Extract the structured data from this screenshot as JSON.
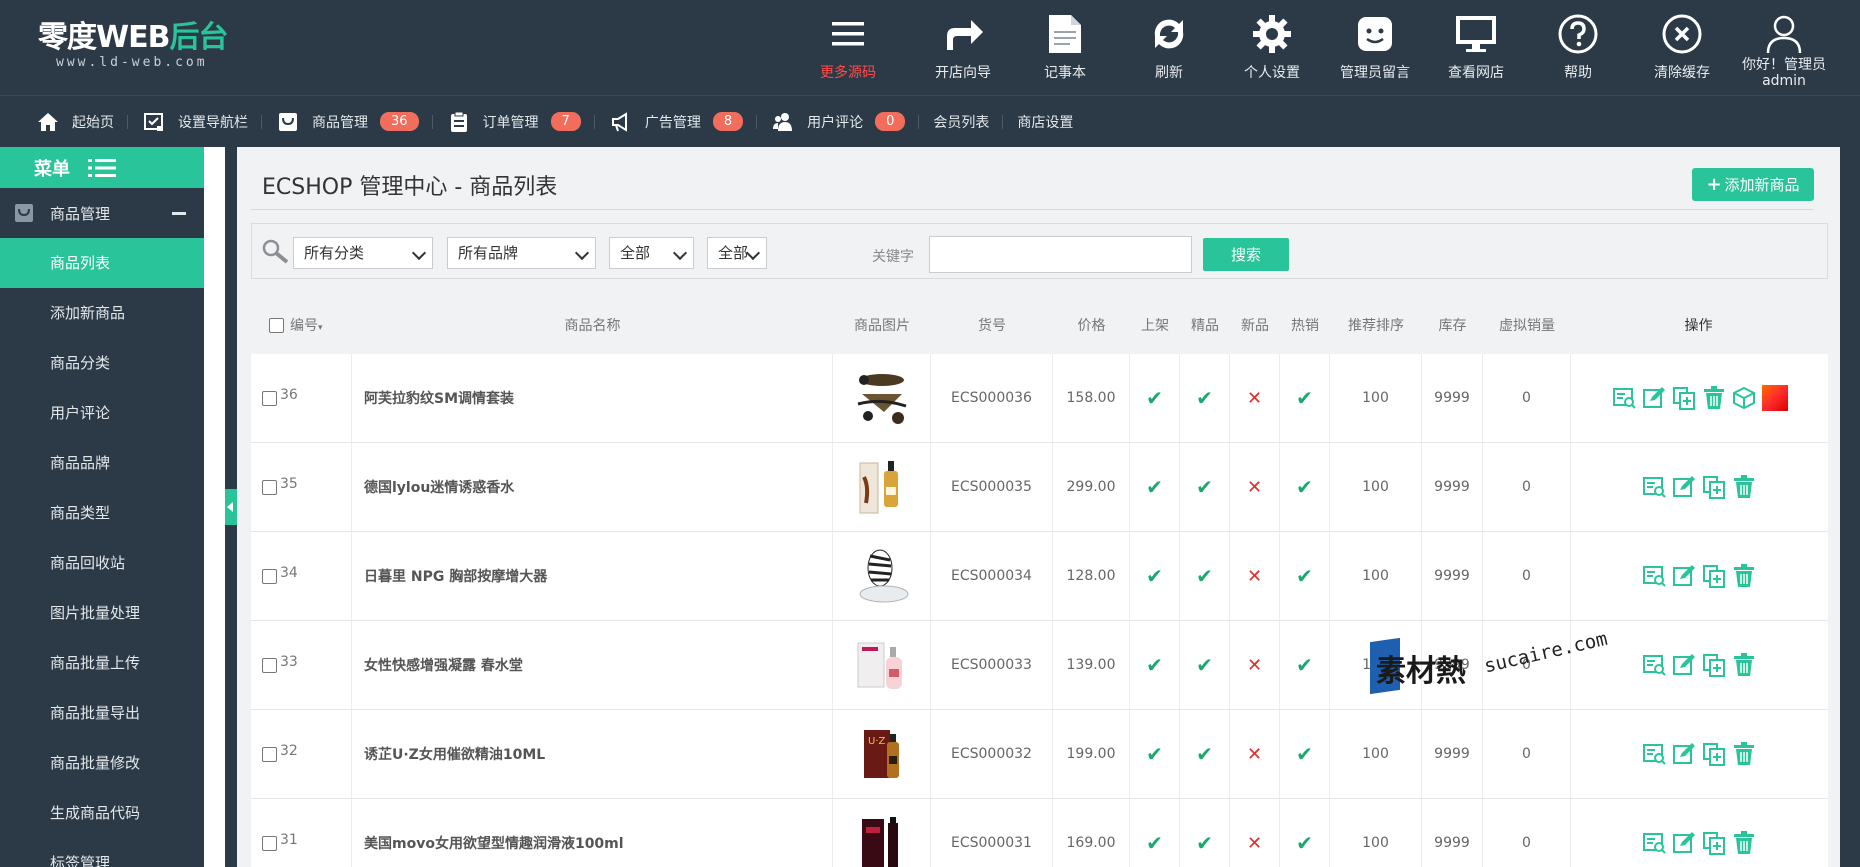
{
  "brand": {
    "name_white": "零度WEB",
    "name_green": "后台",
    "url": "www.ld-web.com"
  },
  "topnav": [
    {
      "label": "更多源码",
      "icon": "menu-icon",
      "hot": true
    },
    {
      "label": "开店向导",
      "icon": "share-arrow-icon"
    },
    {
      "label": "记事本",
      "icon": "notepad-icon"
    },
    {
      "label": "刷新",
      "icon": "refresh-icon"
    },
    {
      "label": "个人设置",
      "icon": "gear-icon"
    },
    {
      "label": "管理员留言",
      "icon": "message-icon"
    },
    {
      "label": "查看网店",
      "icon": "monitor-icon"
    },
    {
      "label": "帮助",
      "icon": "help-icon"
    },
    {
      "label": "清除缓存",
      "icon": "clear-cache-icon"
    }
  ],
  "user": {
    "greeting": "你好！管理员",
    "name": "admin"
  },
  "subnav": [
    {
      "label": "起始页",
      "icon": "home-icon"
    },
    {
      "label": "设置导航栏",
      "icon": "checklist-icon"
    },
    {
      "label": "商品管理",
      "icon": "bag-icon",
      "badge": "36"
    },
    {
      "label": "订单管理",
      "icon": "clipboard-icon",
      "badge": "7"
    },
    {
      "label": "广告管理",
      "icon": "megaphone-icon",
      "badge": "8"
    },
    {
      "label": "用户评论",
      "icon": "users-icon",
      "badge": "0"
    },
    {
      "label": "会员列表"
    },
    {
      "label": "商店设置"
    }
  ],
  "sidebar": {
    "menu_title": "菜单",
    "group": "商品管理",
    "items": [
      "商品列表",
      "添加新商品",
      "商品分类",
      "用户评论",
      "商品品牌",
      "商品类型",
      "商品回收站",
      "图片批量处理",
      "商品批量上传",
      "商品批量导出",
      "商品批量修改",
      "生成商品代码",
      "标签管理"
    ],
    "active_index": 0
  },
  "page": {
    "title": "ECSHOP 管理中心 - 商品列表",
    "add_button": "添加新商品"
  },
  "filters": {
    "category": "所有分类",
    "brand": "所有品牌",
    "filter3": "全部",
    "filter4": "全部",
    "keyword_label": "关键字",
    "keyword_value": "",
    "search_button": "搜索"
  },
  "table": {
    "headers": {
      "id": "编号",
      "name": "商品名称",
      "image": "商品图片",
      "sn": "货号",
      "price": "价格",
      "on_sale": "上架",
      "best": "精品",
      "new": "新品",
      "hot": "热销",
      "sort": "推荐排序",
      "stock": "库存",
      "virtual_sales": "虚拟销量",
      "ops": "操作"
    },
    "rows": [
      {
        "id": "36",
        "name": "阿芙拉豹纹SM调情套装",
        "sn": "ECS000036",
        "price": "158.00",
        "on_sale": true,
        "best": true,
        "new": false,
        "hot": true,
        "sort": "100",
        "stock": "9999",
        "vs": "0",
        "extra_ops": true
      },
      {
        "id": "35",
        "name": "德国lylou迷情诱惑香水",
        "sn": "ECS000035",
        "price": "299.00",
        "on_sale": true,
        "best": true,
        "new": false,
        "hot": true,
        "sort": "100",
        "stock": "9999",
        "vs": "0"
      },
      {
        "id": "34",
        "name": "日暮里 NPG 胸部按摩增大器",
        "sn": "ECS000034",
        "price": "128.00",
        "on_sale": true,
        "best": true,
        "new": false,
        "hot": true,
        "sort": "100",
        "stock": "9999",
        "vs": "0"
      },
      {
        "id": "33",
        "name": "女性快感增强凝露 春水堂",
        "sn": "ECS000033",
        "price": "139.00",
        "on_sale": true,
        "best": true,
        "new": false,
        "hot": true,
        "sort": "100",
        "stock": "9999",
        "vs": "0"
      },
      {
        "id": "32",
        "name": "诱芷U·Z女用催欲精油10ML",
        "sn": "ECS000032",
        "price": "199.00",
        "on_sale": true,
        "best": true,
        "new": false,
        "hot": true,
        "sort": "100",
        "stock": "9999",
        "vs": "0"
      },
      {
        "id": "31",
        "name": "美国movo女用欲望型情趣润滑液100ml",
        "sn": "ECS000031",
        "price": "169.00",
        "on_sale": true,
        "best": true,
        "new": false,
        "hot": true,
        "sort": "100",
        "stock": "9999",
        "vs": "0"
      }
    ],
    "yes_mark": "✔",
    "no_mark": "✕"
  },
  "watermark": {
    "text": "素材熱",
    "url": "sucaire.com"
  },
  "colors": {
    "accent": "#2ac49a",
    "dark": "#2c3a47",
    "badge": "#f26d5b",
    "hot_label": "#ff4b4b",
    "ok": "#1aa86c",
    "no": "#e0302c"
  }
}
